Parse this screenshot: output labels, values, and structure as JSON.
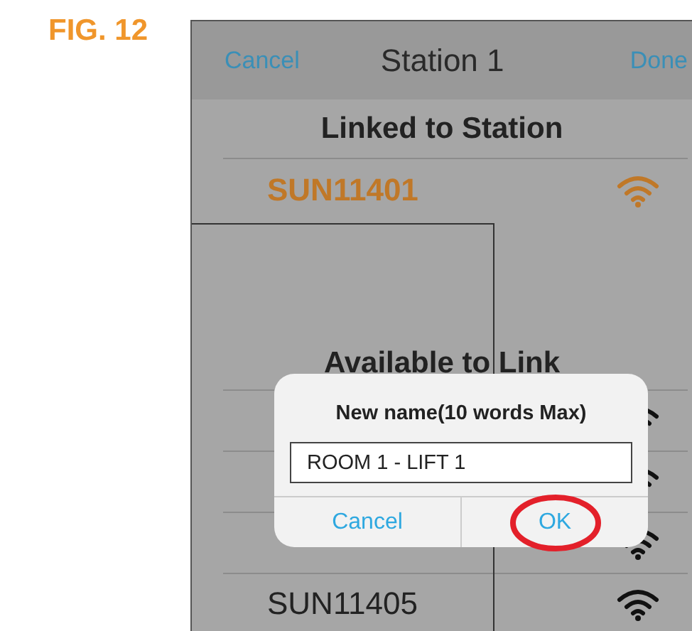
{
  "figure_label": "FIG. 12",
  "nav": {
    "cancel": "Cancel",
    "title": "Station 1",
    "done": "Done"
  },
  "linked": {
    "header": "Linked to Station",
    "stations": [
      {
        "name": "SUN11401"
      }
    ]
  },
  "available": {
    "header": "Available to Link",
    "stations": [
      {
        "kind": "covered"
      },
      {
        "kind": "covered"
      },
      {
        "kind": "covered"
      },
      {
        "kind": "station",
        "name": "SUN11405"
      }
    ]
  },
  "dialog": {
    "title": "New name(10 words Max)",
    "value": "ROOM 1 - LIFT 1",
    "buttons": [
      {
        "label": "Cancel",
        "highlighted": false
      },
      {
        "label": "OK",
        "highlighted": true
      }
    ]
  }
}
